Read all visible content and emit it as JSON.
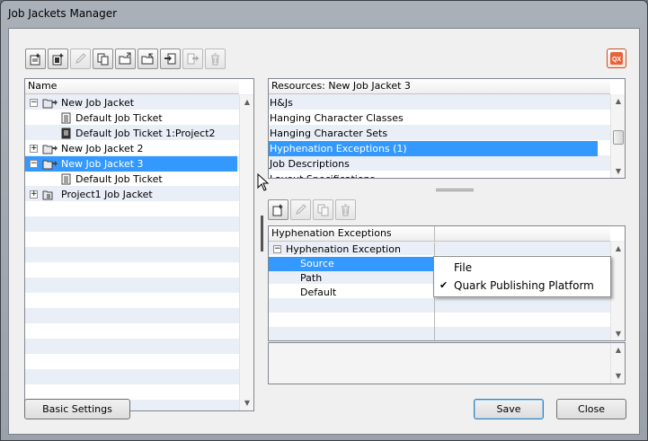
{
  "window": {
    "title": "Job Jackets Manager"
  },
  "toolbar": {
    "buttons": [
      {
        "icon": "new-job-jacket-icon"
      },
      {
        "icon": "new-job-ticket-icon"
      },
      {
        "icon": "edit-pencil-icon"
      },
      {
        "icon": "duplicate-icon"
      },
      {
        "icon": "open-folder-icon"
      },
      {
        "icon": "open-folder-alt-icon"
      },
      {
        "icon": "import-icon"
      },
      {
        "icon": "export-icon"
      },
      {
        "icon": "delete-trash-icon"
      }
    ],
    "quark_icon_label": "QX"
  },
  "left_tree": {
    "header": "Name",
    "items": [
      {
        "label": "New Job Jacket",
        "expander": "−"
      },
      {
        "label": "Default Job Ticket"
      },
      {
        "label": "Default Job Ticket 1:Project2"
      },
      {
        "label": "New Job Jacket 2",
        "expander": "+"
      },
      {
        "label": "New Job Jacket 3",
        "expander": "−"
      },
      {
        "label": "Default Job Ticket"
      },
      {
        "label": "Project1 Job Jacket",
        "expander": "+"
      }
    ]
  },
  "resources": {
    "header": "Resources: New Job Jacket 3",
    "items": [
      "H&Js",
      "Hanging Character Classes",
      "Hanging Character Sets",
      "Hyphenation Exceptions (1)",
      "Job Descriptions",
      "Layout Specifications"
    ],
    "selected_index": 3
  },
  "details": {
    "header": "Hyphenation Exceptions",
    "rows": [
      {
        "label": "Hyphenation Exception",
        "expander": "−"
      },
      {
        "label": "Source"
      },
      {
        "label": "Path"
      },
      {
        "label": "Default"
      }
    ]
  },
  "source_menu": {
    "items": [
      {
        "label": "File",
        "checked": false
      },
      {
        "label": "Quark Publishing Platform",
        "checked": true,
        "check": "✔"
      }
    ]
  },
  "buttons": {
    "basic_settings": "Basic Settings",
    "save": "Save",
    "close": "Close"
  },
  "colors": {
    "selection": "#3399ff",
    "quark_accent": "#c74b1f"
  }
}
